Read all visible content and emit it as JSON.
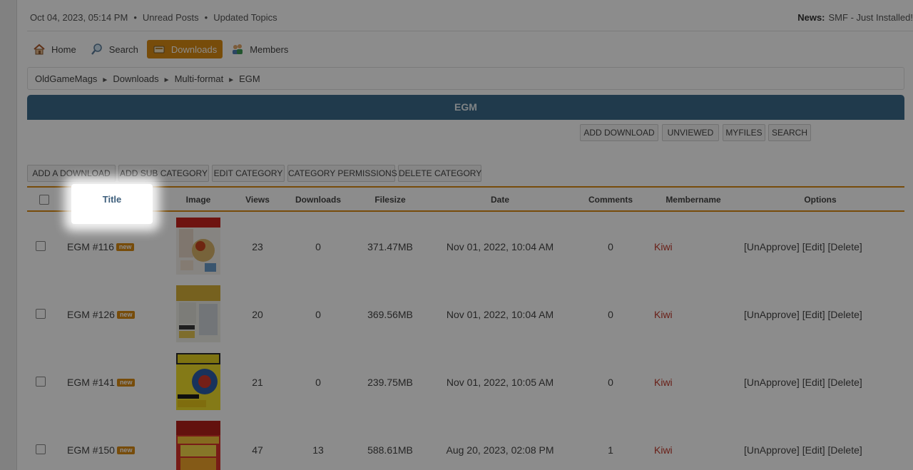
{
  "topbar": {
    "datetime": "Oct 04, 2023, 05:14 PM",
    "links": [
      "Unread Posts",
      "Updated Topics"
    ],
    "news_label": "News:",
    "news_text": "SMF - Just Installed!"
  },
  "nav": {
    "items": [
      {
        "label": "Home",
        "icon": "home-icon"
      },
      {
        "label": "Search",
        "icon": "search-icon"
      },
      {
        "label": "Downloads",
        "icon": "downloads-icon",
        "active": true
      },
      {
        "label": "Members",
        "icon": "members-icon"
      }
    ]
  },
  "breadcrumb": [
    "OldGameMags",
    "Downloads",
    "Multi-format",
    "EGM"
  ],
  "category": {
    "title": "EGM"
  },
  "top_buttons": [
    "ADD DOWNLOAD",
    "UNVIEWED",
    "MYFILES",
    "SEARCH"
  ],
  "admin_buttons": [
    "ADD A DOWNLOAD",
    "ADD SUB CATEGORY",
    "EDIT CATEGORY",
    "CATEGORY PERMISSIONS",
    "DELETE CATEGORY"
  ],
  "table": {
    "columns": [
      "Title",
      "Image",
      "Views",
      "Downloads",
      "Filesize",
      "Date",
      "Comments",
      "Membername",
      "Options"
    ],
    "new_badge": "new",
    "options": [
      "[UnApprove]",
      "[Edit]",
      "[Delete]"
    ],
    "rows": [
      {
        "title": "EGM #116",
        "views": "23",
        "downloads": "0",
        "filesize": "371.47MB",
        "date": "Nov 01, 2022, 10:04 AM",
        "comments": "0",
        "member": "Kiwi"
      },
      {
        "title": "EGM #126",
        "views": "20",
        "downloads": "0",
        "filesize": "369.56MB",
        "date": "Nov 01, 2022, 10:04 AM",
        "comments": "0",
        "member": "Kiwi"
      },
      {
        "title": "EGM #141",
        "views": "21",
        "downloads": "0",
        "filesize": "239.75MB",
        "date": "Nov 01, 2022, 10:05 AM",
        "comments": "0",
        "member": "Kiwi"
      },
      {
        "title": "EGM #150",
        "views": "47",
        "downloads": "13",
        "filesize": "588.61MB",
        "date": "Aug 20, 2023, 02:08 PM",
        "comments": "1",
        "member": "Kiwi"
      }
    ]
  },
  "colors": {
    "accent": "#d98a13",
    "header_bar": "#3b6a8a",
    "member_link": "#c0392b"
  }
}
